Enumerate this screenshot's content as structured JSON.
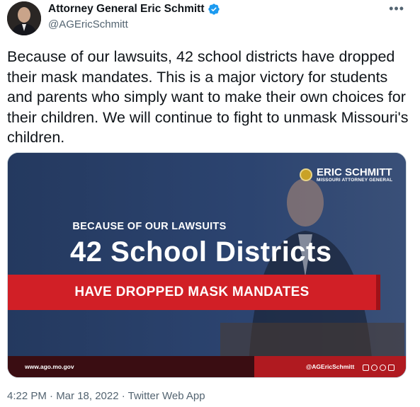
{
  "author": {
    "name": "Attorney General Eric Schmitt",
    "handle": "@AGEricSchmitt",
    "verified_color": "#1d9bf0"
  },
  "tweet": {
    "text": "Because of our lawsuits, 42 school districts have dropped their mask mandates. This is a major victory for students and parents who simply want to make their own choices for their children. We will continue to fight to unmask Missouri's children."
  },
  "graphic": {
    "brand_name": "ERIC SCHMITT",
    "brand_subtitle": "MISSOURI ATTORNEY GENERAL",
    "kicker": "BECAUSE OF OUR LAWSUITS",
    "headline": "42 School Districts",
    "banner": "HAVE DROPPED MASK MANDATES",
    "footer_url": "www.ago.mo.gov",
    "footer_handle": "@AGEricSchmitt",
    "colors": {
      "navy": "#1e3358",
      "red": "#d11f26",
      "dark_red": "#3a0d12"
    }
  },
  "meta": {
    "timestamp": "4:22 PM · Mar 18, 2022 · Twitter Web App"
  },
  "icons": {
    "verified": "verified-badge-icon",
    "more": "more-options-icon",
    "social": [
      "instagram-icon",
      "facebook-icon",
      "twitter-icon",
      "youtube-icon"
    ]
  }
}
